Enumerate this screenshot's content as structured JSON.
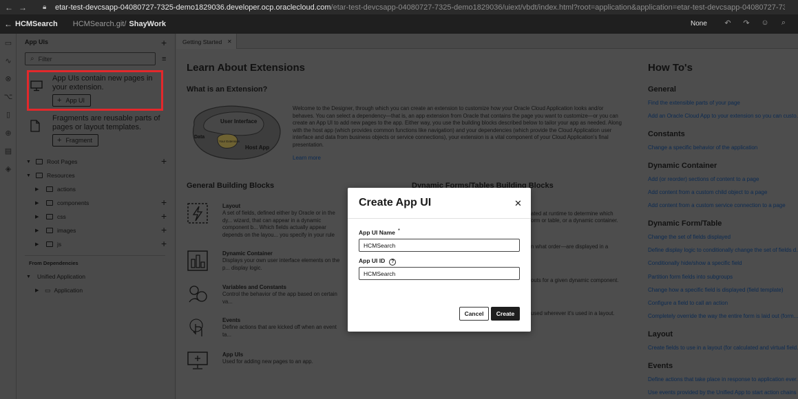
{
  "browser": {
    "url_host": "etar-test-devcsapp-04080727-7325-demo1829036.developer.ocp.oraclecloud.com",
    "url_path": "/etar-test-devcsapp-04080727-7325-demo1829036/uiext/vbdt/index.html?root=application&application=etar-test-devcsapp-04080727-7325-demo18290..."
  },
  "header": {
    "app_name": "HCMSearch",
    "repo": "HCMSearch.git/",
    "branch": "ShayWork",
    "mode": "None"
  },
  "side": {
    "title": "App UIs",
    "filter_placeholder": "Filter",
    "card_app_ui_text": "App UIs contain new pages in your extension.",
    "card_app_ui_button": "App UI",
    "card_fragment_text": "Fragments are reusable parts of pages or layout templates.",
    "card_fragment_button": "Fragment",
    "tree": {
      "root_pages": "Root Pages",
      "resources": "Resources",
      "actions": "actions",
      "components": "components",
      "css": "css",
      "images": "images",
      "js": "js"
    },
    "dependencies_label": "From Dependencies",
    "unified_application": "Unified Application",
    "application": "Application"
  },
  "tab": {
    "label": "Getting Started"
  },
  "main": {
    "title": "Learn About Extensions",
    "what_is": "What is an Extension?",
    "diagram": {
      "ui": "User Interface",
      "data": "Data",
      "ext": "Your Extension",
      "host": "Host App"
    },
    "intro": "Welcome to the Designer, through which you can create an extension to customize how your Oracle Cloud Application looks and/or behaves. You can select a dependency—that is, an app extension from Oracle that contains the page you want to customize—or you can create an App UI to add new pages to the app. Either way, you use the building blocks described below to tailor your app as needed. Along with the host app (which provides common functions like navigation) and your dependencies (which provide the Cloud Application user interface and data from business objects or service connections), your extension is a vital component of your Cloud Application's final presentation.",
    "learn_more": "Learn more",
    "general_blocks": "General Building Blocks",
    "dynamic_blocks": "Dynamic Forms/Tables Building Blocks",
    "blocks": [
      {
        "title": "Layout",
        "desc": "A set of fields, defined either by Oracle or in the dy... wizard, that can appear in a dynamic component b... Which fields actually appear depends on the layou... you specify in your rule sets."
      },
      {
        "title": "Dynamic Container",
        "desc": "Displays your own user interface elements on the p... display logic."
      },
      {
        "title": "Variables and Constants",
        "desc": "Control the behavior of the app based on certain va..."
      },
      {
        "title": "Events",
        "desc": "Define actions that are kicked off when an event ta..."
      },
      {
        "title": "App UIs",
        "desc": "Used for adding new pages to an app."
      }
    ],
    "dyn_fragments": [
      "ated at runtime to determine which",
      "orm or table, or a dynamic container.",
      "n what order—are displayed in a",
      "outs for a given dynamic component.",
      "used wherever it's used in a layout."
    ]
  },
  "howto": {
    "title": "How To's",
    "sections": [
      {
        "heading": "General",
        "links": [
          "Find the extensible parts of your page",
          "Add an Oracle Cloud App to your extension so you can custo..."
        ]
      },
      {
        "heading": "Constants",
        "links": [
          "Change a specific behavior of the application"
        ]
      },
      {
        "heading": "Dynamic Container",
        "links": [
          "Add (or reorder) sections of content to a page",
          "Add content from a custom child object to a page",
          "Add content from a custom service connection to a page"
        ]
      },
      {
        "heading": "Dynamic Form/Table",
        "links": [
          "Change the set of fields displayed",
          "Define display logic to conditionally change the set of fields d...",
          "Conditionally hide/show a specific field",
          "Partition form fields into subgroups",
          "Change how a specific field is displayed (field template)",
          "Configure a field to call an action",
          "Completely override the way the entire form is laid out (form..."
        ]
      },
      {
        "heading": "Layout",
        "links": [
          "Create fields to use in a layout (for calculated and virtual field..."
        ]
      },
      {
        "heading": "Events",
        "links": [
          "Define actions that take place in response to application ever...",
          "Use events provided by the Unified App to start action chains"
        ]
      }
    ]
  },
  "modal": {
    "title": "Create App UI",
    "name_label": "App UI Name",
    "required_mark": "*",
    "name_value": "HCMSearch",
    "id_label": "App UI ID",
    "id_value": "HCMSearch",
    "cancel": "Cancel",
    "create": "Create"
  }
}
